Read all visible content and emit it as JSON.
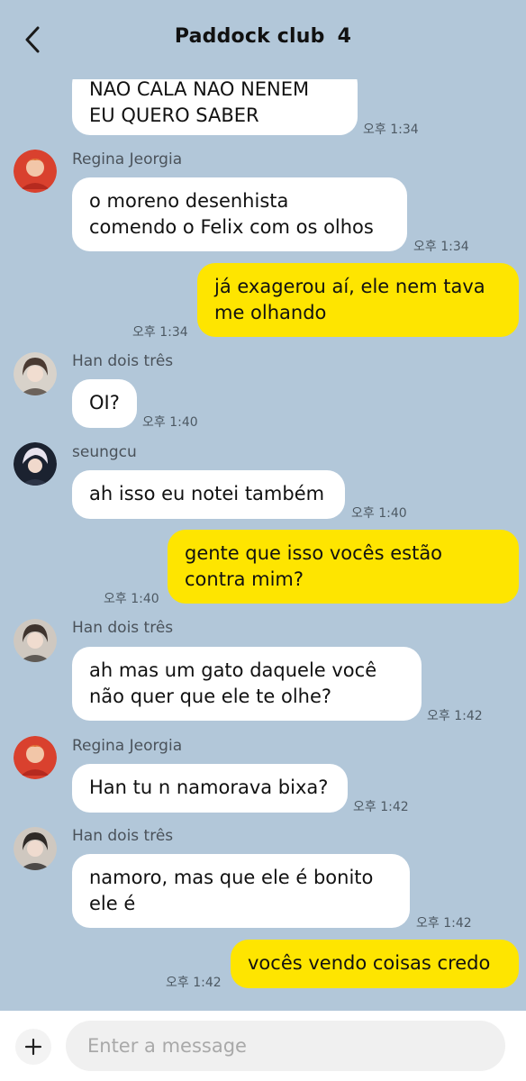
{
  "header": {
    "title": "Paddock club",
    "count": "4",
    "back_icon": "chevron-left-icon"
  },
  "colors": {
    "background": "#b2c7d9",
    "incoming_bubble": "#ffffff",
    "outgoing_bubble": "#fee500"
  },
  "messages": [
    {
      "from": "other",
      "lines": [
        "NAO CALA NAO NENEM",
        "EU QUERO SABER"
      ],
      "time": "오후 1:34"
    },
    {
      "from": "other",
      "sender": "Regina Jeorgia",
      "lines": [
        "o moreno desenhista",
        "comendo o Felix com os olhos"
      ],
      "time": "오후 1:34"
    },
    {
      "from": "me",
      "lines": [
        "já exagerou aí, ele nem tava",
        "me olhando"
      ],
      "time": "오후 1:34"
    },
    {
      "from": "other",
      "sender": "Han dois três",
      "lines": [
        "OI?"
      ],
      "time": "오후 1:40"
    },
    {
      "from": "other",
      "sender": "seungcu",
      "lines": [
        "ah isso eu notei também"
      ],
      "time": "오후 1:40"
    },
    {
      "from": "me",
      "lines": [
        "gente que isso vocês estão",
        "contra mim?"
      ],
      "time": "오후 1:40"
    },
    {
      "from": "other",
      "sender": "Han dois três",
      "lines": [
        "ah mas um gato daquele você",
        "não quer que ele te olhe?"
      ],
      "time": "오후 1:42"
    },
    {
      "from": "other",
      "sender": "Regina Jeorgia",
      "lines": [
        "Han tu n namorava bixa?"
      ],
      "time": "오후 1:42"
    },
    {
      "from": "other",
      "sender": "Han dois três",
      "lines": [
        "namoro, mas que ele é bonito",
        "ele é"
      ],
      "time": "오후 1:42"
    },
    {
      "from": "me",
      "lines": [
        "vocês vendo coisas credo"
      ],
      "time": "오후 1:42"
    }
  ],
  "composer": {
    "placeholder": "Enter a message",
    "plus_icon": "plus-icon"
  }
}
